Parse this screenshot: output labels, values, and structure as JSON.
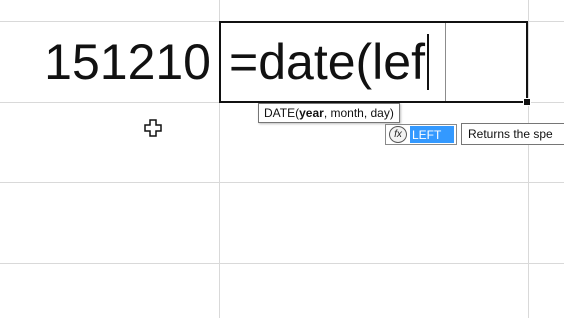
{
  "cells": {
    "left_value": "151210",
    "active_formula": "=date(lef"
  },
  "formula_tooltip": {
    "func": "DATE(",
    "arg_current": "year",
    "rest": ", month, day)"
  },
  "autocomplete": {
    "icon_glyph": "fx",
    "selected_item": "LEFT",
    "description": "Returns the spe"
  },
  "colors": {
    "selection_blue": "#3399ff",
    "gridline": "#d9d9d9"
  },
  "icons": {
    "cursor": "cell-select-cross-icon",
    "function": "function-icon"
  }
}
